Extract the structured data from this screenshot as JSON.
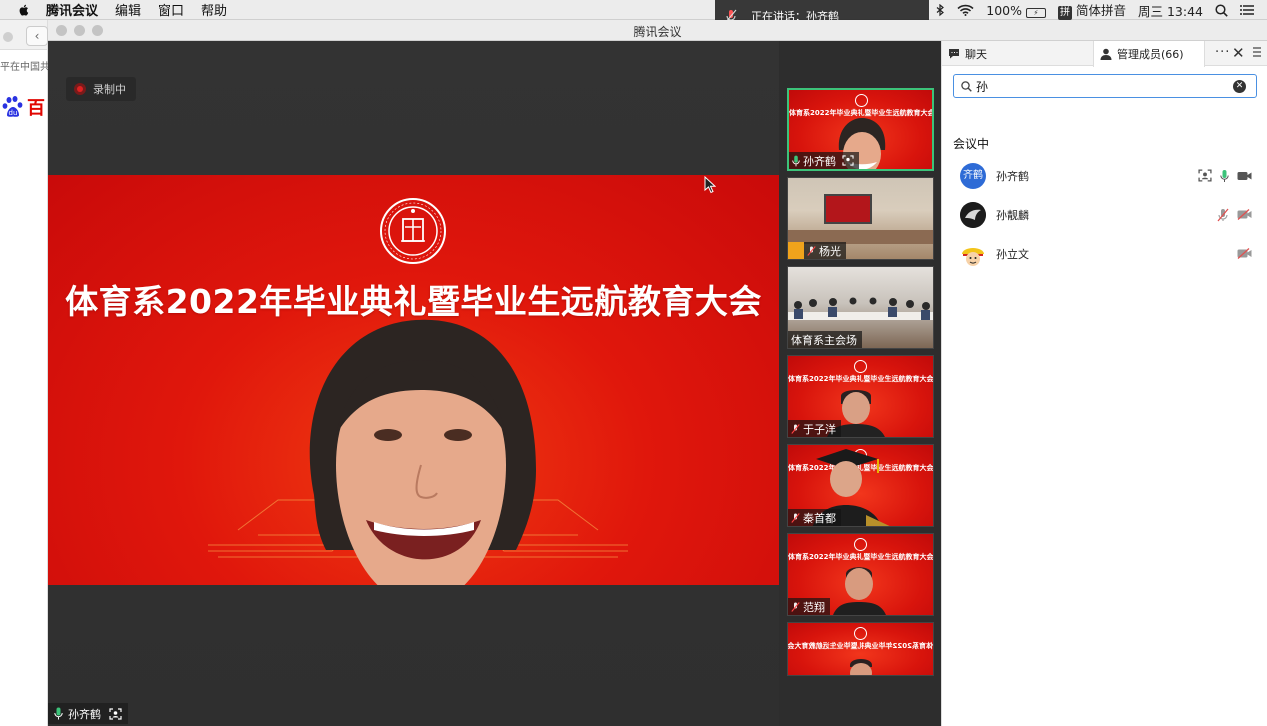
{
  "menubar": {
    "app_name": "腾讯会议",
    "menus": [
      "编辑",
      "窗口",
      "帮助"
    ],
    "battery_text": "100%",
    "input_method": "简体拼音",
    "input_method_badge": "拼",
    "clock": "周三 13:44"
  },
  "speaking_toast": {
    "text": "正在讲话：孙齐鹤"
  },
  "browser_bg": {
    "snippet": "平在中国共",
    "logo_text": "百"
  },
  "window": {
    "title": "腾讯会议"
  },
  "main": {
    "recording_label": "录制中",
    "banner_title": "体育系2022年毕业典礼暨毕业生远航教育大会",
    "speaker_name": "孙齐鹤"
  },
  "thumbnails": [
    {
      "name": "孙齐鹤",
      "mic": "on",
      "kind": "speaker"
    },
    {
      "name": "杨光",
      "mic": "off",
      "kind": "room-screen"
    },
    {
      "name": "体育系主会场",
      "mic": "none",
      "kind": "room-people"
    },
    {
      "name": "于子洋",
      "mic": "off",
      "kind": "red"
    },
    {
      "name": "秦首都",
      "mic": "off",
      "kind": "red-grad"
    },
    {
      "name": "范翔",
      "mic": "off",
      "kind": "red"
    },
    {
      "name": "",
      "mic": "none",
      "kind": "red-mirror"
    }
  ],
  "thumb_mini_title": "体育系2022年毕业典礼暨毕业生远航教育大会",
  "panel": {
    "tab_chat": "聊天",
    "tab_members": "管理成员(66)",
    "search_value": "孙",
    "section_title": "会议中",
    "members": [
      {
        "name": "孙齐鹤",
        "avatar_text": "齐鹤",
        "mic": "on",
        "video": "on",
        "screen": true
      },
      {
        "name": "孙靓麟",
        "avatar_text": "",
        "mic": "off",
        "video": "off",
        "screen": false
      },
      {
        "name": "孙立文",
        "avatar_text": "",
        "mic": "none",
        "video": "off",
        "screen": false
      }
    ]
  },
  "colors": {
    "accent_green": "#3cc37a",
    "banner_red": "#e0170c",
    "search_border": "#4a90e2"
  }
}
